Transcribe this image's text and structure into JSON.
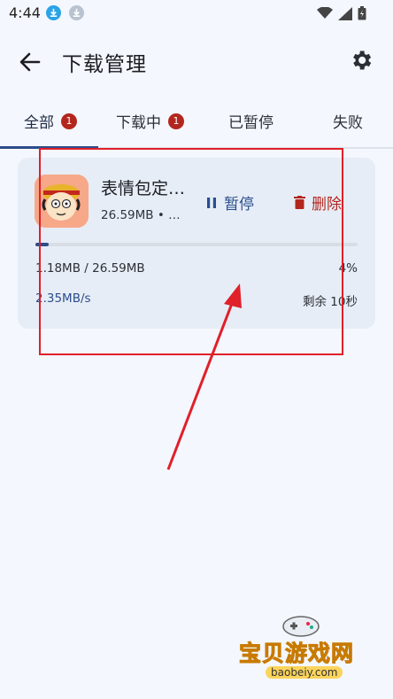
{
  "status_bar": {
    "time": "4:44"
  },
  "app_bar": {
    "title": "下载管理"
  },
  "tabs": [
    {
      "label": "全部",
      "badge": "1"
    },
    {
      "label": "下载中",
      "badge": "1"
    },
    {
      "label": "已暂停"
    },
    {
      "label": "失败"
    }
  ],
  "download": {
    "name": "表情包定…",
    "meta": "26.59MB • …",
    "pause_label": "暂停",
    "delete_label": "删除",
    "progress_fraction": 0.04,
    "size_progress": "1.18MB / 26.59MB",
    "percent": "4%",
    "speed": "2.35MB/s",
    "remaining": "剩余 10秒"
  },
  "watermark": {
    "text": "宝贝游戏网",
    "url": "baobeiy.com"
  },
  "colors": {
    "accent": "#2d4c8a",
    "danger": "#b3261e",
    "annotation": "#e0202a"
  }
}
